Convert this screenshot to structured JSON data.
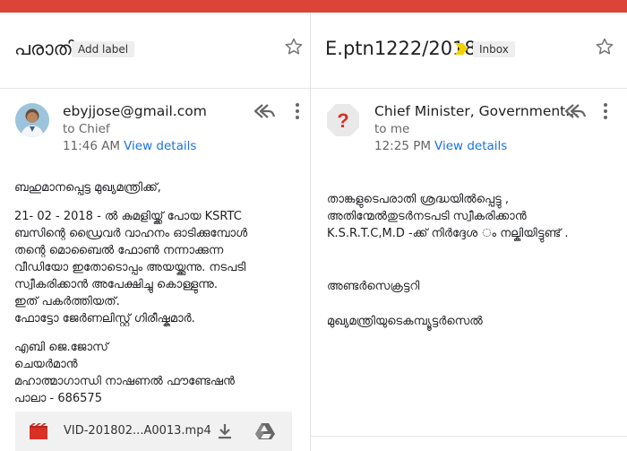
{
  "left": {
    "subject": "പരാതി",
    "add_label": "Add label",
    "sender": "ebyjjose@gmail.com",
    "to": "to Chief",
    "time": "11:46 AM",
    "view_details": "View details",
    "body": [
      [
        "ബഹുമാനപ്പെട്ട മുഖ്യമന്ത്രിക്ക്,"
      ],
      [
        "21- 02 - 2018 - ൽ കുമളിയ്ക്ക് പോയ KSRTC",
        "ബസിന്റെ ഡ്രൈവർ വാഹനം ഓടിക്കുമ്പോൾ",
        "തന്റെ മൊബൈൽ ഫോൺ നന്നാക്കുന്ന",
        "വീഡിയോ ഇതോടൊപ്പം അയയ്ക്കുന്നു. നടപടി",
        "സ്വീകരിക്കാൻ അപേക്ഷിച്ചു കൊള്ളുന്നു.",
        "ഇത് പകർത്തിയത്.",
        "ഫോട്ടോ ജേർണലിസ്റ്റ് ഗിരീഷ്കുമാർ."
      ],
      [
        "എബി ജെ.ജോസ്",
        "ചെയർമാൻ",
        "മഹാത്മാഗാന്ധി നാഷണൽ ഫൗണ്ടേഷൻ",
        "പാലാ - 686575"
      ]
    ],
    "attachment": "VID-201802...A0013.mp4"
  },
  "right": {
    "subject": "E.ptn1222/2018",
    "inbox_label": "Inbox",
    "sender": "Chief Minister, Government...",
    "avatar_glyph": "?",
    "to": "to me",
    "time": "12:25 PM",
    "view_details": "View details",
    "body": [
      [
        "താങ്കളുടെപരാതി ശ്രദ്ധയിൽപ്പെട്ടു ,",
        "അതിന്മേൽതുടർനടപടി  സ്വീകരിക്കാൻ",
        "K.S.R.T.C,M.D -ക്ക് നിർദ്ദേശ ം  നല്കിയിട്ടുണ്ട് ."
      ],
      [
        "അണ്ടർസെക്രട്ടറി"
      ],
      [
        "മുഖ്യമന്ത്രിയുടെകമ്പ്യൂട്ടർസെൽ"
      ]
    ]
  },
  "colors": {
    "topbar": "#db4437",
    "link": "#1a73e8",
    "importance": "#f4d100",
    "video_icon": "#d93025"
  },
  "icons": [
    "star-icon",
    "reply-all-icon",
    "more-vert-icon",
    "importance-marker-icon",
    "video-file-icon",
    "download-icon",
    "drive-icon",
    "unknown-sender-icon"
  ]
}
